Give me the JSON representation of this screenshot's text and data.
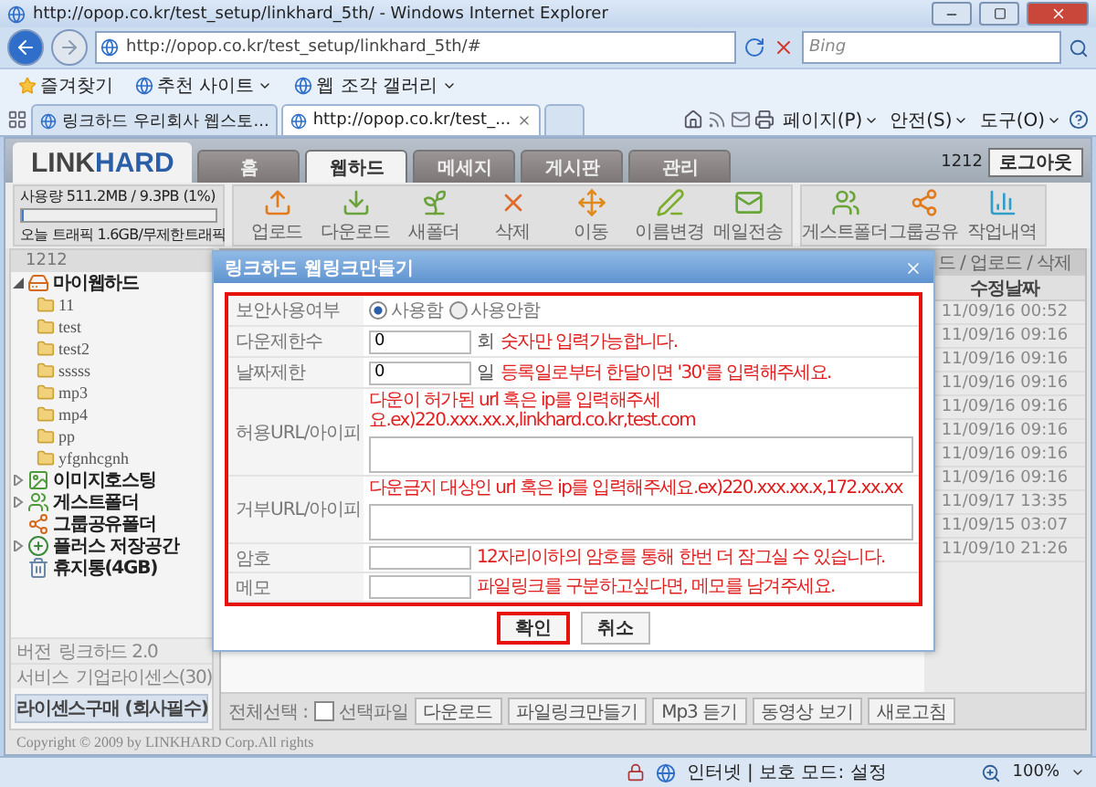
{
  "browser": {
    "title": "http://opop.co.kr/test_setup/linkhard_5th/ - Windows Internet Explorer",
    "address": "http://opop.co.kr/test_setup/linkhard_5th/#",
    "search_placeholder": "Bing",
    "favorites": [
      {
        "label": "즐겨찾기",
        "kind": "favorites"
      },
      {
        "label": "추천 사이트",
        "kind": "menu"
      },
      {
        "label": "웹 조각 갤러리",
        "kind": "menu"
      }
    ],
    "tabs": [
      {
        "label": "링크하드 우리회사 웹스토...",
        "selected": false
      },
      {
        "label": "http://opop.co.kr/test_...",
        "selected": true
      }
    ],
    "commands": [
      "페이지(P)",
      "안전(S)",
      "도구(O)"
    ]
  },
  "site": {
    "logo": [
      "LINK",
      "HARD"
    ],
    "nav_tabs": [
      {
        "label": "홈",
        "selected": false
      },
      {
        "label": "웹하드",
        "selected": true
      },
      {
        "label": "메세지",
        "selected": false
      },
      {
        "label": "게시판",
        "selected": false
      },
      {
        "label": "관리",
        "selected": false
      }
    ],
    "user": "1212",
    "logout": "로그아웃",
    "usage": {
      "label": "사용량 511.2MB / 9.3PB (1%)",
      "level": 0.01,
      "traffic": "오늘 트래픽 1.6GB/무제한트래픽"
    },
    "toolbar": [
      [
        {
          "label": "업로드",
          "kind": "upload"
        },
        {
          "label": "다운로드",
          "kind": "download"
        },
        {
          "label": "새폴더",
          "kind": "newfolder"
        },
        {
          "label": "삭제",
          "kind": "delete"
        },
        {
          "label": "이동",
          "kind": "move"
        },
        {
          "label": "이름변경",
          "kind": "rename"
        },
        {
          "label": "메일전송",
          "kind": "mail"
        }
      ],
      [
        {
          "label": "게스트폴더",
          "kind": "guest"
        },
        {
          "label": "그룹공유",
          "kind": "group"
        },
        {
          "label": "작업내역",
          "kind": "history"
        }
      ]
    ]
  },
  "sidebar": {
    "header": "1212",
    "tree": [
      {
        "label": "마이웹하드",
        "kind": "drive",
        "expanded": true,
        "children": [
          {
            "label": "11"
          },
          {
            "label": "test"
          },
          {
            "label": "test2"
          },
          {
            "label": "sssss"
          },
          {
            "label": "mp3"
          },
          {
            "label": "mp4"
          },
          {
            "label": "pp"
          },
          {
            "label": "yfgnhcgnh"
          }
        ]
      },
      {
        "label": "이미지호스팅",
        "kind": "image",
        "expanded": false
      },
      {
        "label": "게스트폴더",
        "kind": "guest",
        "expanded": false
      },
      {
        "label": "그룹공유폴더",
        "kind": "group"
      },
      {
        "label": "플러스 저장공간",
        "kind": "plus",
        "expanded": false
      },
      {
        "label": "휴지통(4GB)",
        "kind": "trash"
      }
    ],
    "info": [
      {
        "label": "버전",
        "value": "링크하드 2.0"
      },
      {
        "label": "서비스",
        "value": "기업라이센스(30)"
      }
    ],
    "license_button": "라이센스구매 (회사필수)"
  },
  "file_list": {
    "header": "드 / 업로드 / 삭제",
    "column": "수정날짜",
    "dates": [
      "11/09/16 00:52",
      "11/09/16 09:16",
      "11/09/16 09:16",
      "11/09/16 09:16",
      "11/09/16 09:16",
      "11/09/16 09:16",
      "11/09/16 09:16",
      "11/09/16 09:16",
      "11/09/17 13:35",
      "11/09/15 03:07",
      "11/09/10 21:26"
    ]
  },
  "bottom_bar": {
    "select_all": "전체선택 :",
    "selected_files": {
      "label": "선택파일",
      "checked": false
    },
    "buttons": [
      "다운로드",
      "파일링크만들기",
      "Mp3 듣기",
      "동영상 보기",
      "새로고침"
    ]
  },
  "copyright": "Copyright © 2009 by LINKHARD Corp.All rights",
  "status_bar": {
    "zone": "인터넷 | 보호 모드: 설정",
    "zoom": "100%"
  },
  "dialog": {
    "title": "링크하드 웹링크만들기",
    "rows": [
      {
        "kind": "radio",
        "label": "보안사용여부",
        "options": [
          {
            "label": "사용함",
            "selected": true
          },
          {
            "label": "사용안함",
            "selected": false
          }
        ]
      },
      {
        "kind": "input",
        "label": "다운제한수",
        "value": "0",
        "unit": "회",
        "hint": "숫자만 입력가능합니다."
      },
      {
        "kind": "input",
        "label": "날짜제한",
        "value": "0",
        "unit": "일",
        "hint": "등록일로부터 한달이면 '30'를 입력해주세요."
      },
      {
        "kind": "textarea",
        "label": "허용URL/아이피",
        "hint": "다운이 허가된 url 혹은 ip를 입력해주세요.ex)220.xxx.xx.x,linkhard.co.kr,test.com"
      },
      {
        "kind": "textarea",
        "label": "거부URL/아이피",
        "hint": "다운금지 대상인 url 혹은 ip를 입력해주세요.ex)220.xxx.xx.x,172.xx.xx"
      },
      {
        "kind": "input",
        "label": "암호",
        "hint": "12자리이하의 암호를 통해 한번 더 잠그실 수 있습니다."
      },
      {
        "kind": "input",
        "label": "메모",
        "hint": "파일링크를 구분하고싶다면, 메모를 남겨주세요."
      }
    ],
    "buttons": [
      {
        "label": "확인",
        "focused": true
      },
      {
        "label": "취소",
        "focused": false
      }
    ]
  }
}
